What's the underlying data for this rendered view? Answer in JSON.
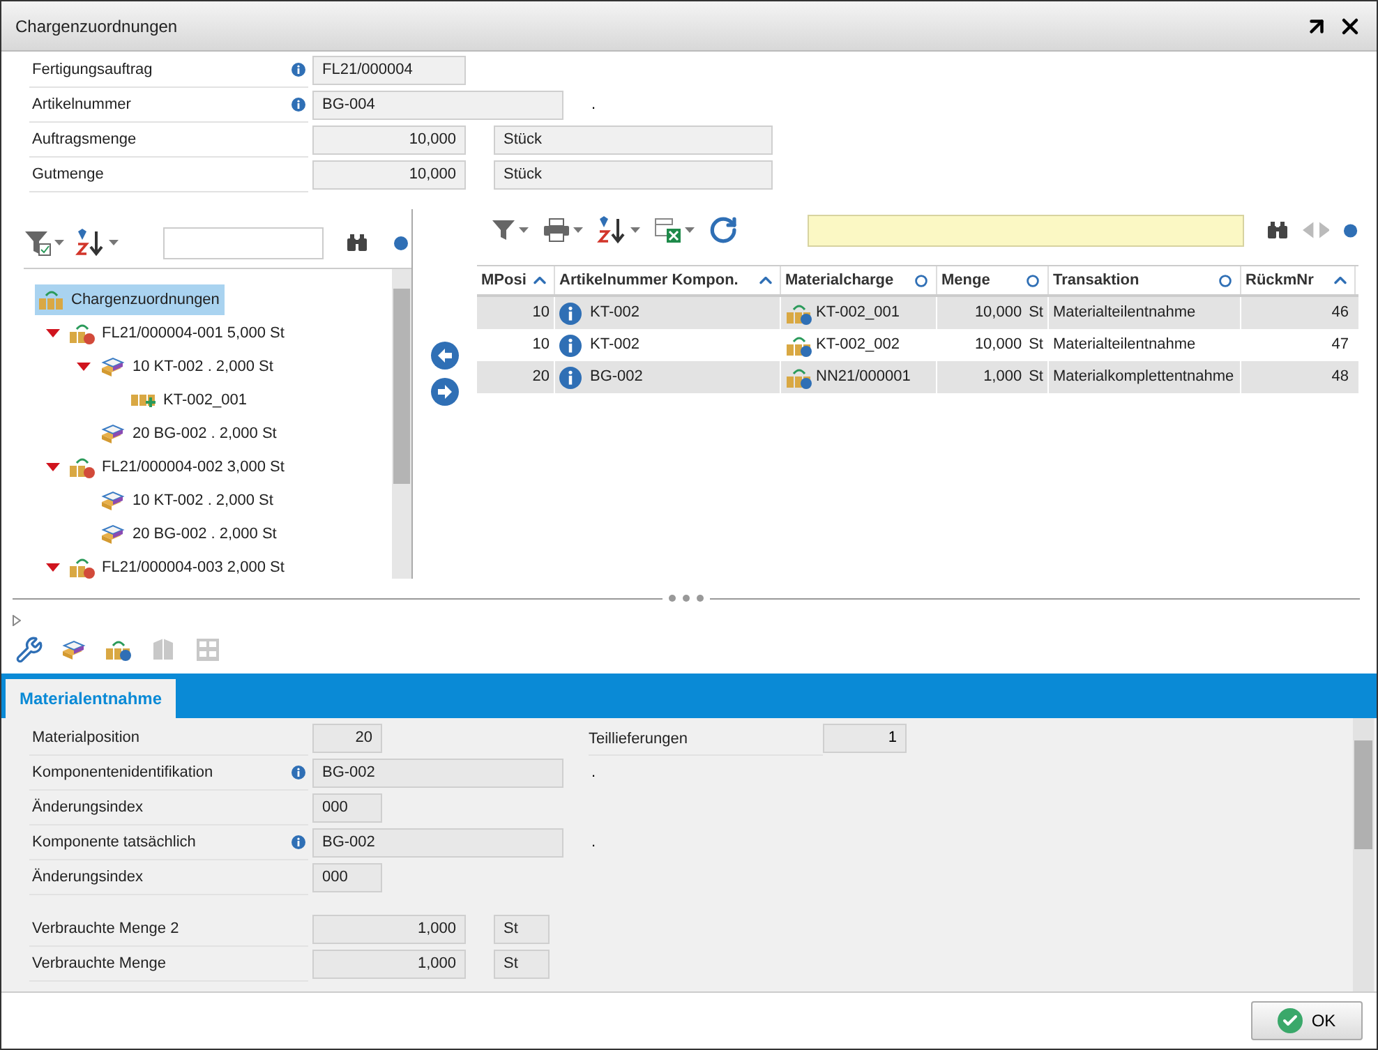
{
  "window": {
    "title": "Chargenzuordnungen"
  },
  "header_fields": [
    {
      "label": "Fertigungsauftrag",
      "info": true,
      "kind": "short",
      "value": "FL21/000004"
    },
    {
      "label": "Artikelnummer",
      "info": true,
      "kind": "long",
      "value": "BG-004",
      "note": "."
    },
    {
      "label": "Auftragsmenge",
      "info": false,
      "kind": "number",
      "value": "10,000",
      "unit": "Stück"
    },
    {
      "label": "Gutmenge",
      "info": false,
      "kind": "number",
      "value": "10,000",
      "unit": "Stück"
    }
  ],
  "tree": [
    {
      "label": "Chargenzuordnungen",
      "kind": "batch",
      "selected": true,
      "children": [
        {
          "label": "FL21/000004-001 5,000 St",
          "kind": "order",
          "selected": false,
          "expanded": true,
          "children": [
            {
              "label": "10 KT-002 . 2,000 St",
              "kind": "component",
              "selected": false,
              "expanded": true,
              "children": [
                {
                  "label": "KT-002_001",
                  "kind": "batch-add",
                  "selected": false
                }
              ]
            },
            {
              "label": "20 BG-002 . 2,000 St",
              "kind": "component",
              "selected": false
            }
          ]
        },
        {
          "label": "FL21/000004-002 3,000 St",
          "kind": "order",
          "selected": false,
          "expanded": true,
          "children": [
            {
              "label": "10 KT-002 . 2,000 St",
              "kind": "component",
              "selected": false
            },
            {
              "label": "20 BG-002 . 2,000 St",
              "kind": "component",
              "selected": false
            }
          ]
        },
        {
          "label": "FL21/000004-003 2,000 St",
          "kind": "order",
          "selected": false,
          "expanded": true
        }
      ]
    }
  ],
  "table": {
    "columns": [
      {
        "label": "MPosi",
        "kind": "asc"
      },
      {
        "label": "Artikelnummer Kompon.",
        "kind": "asc"
      },
      {
        "label": "Materialcharge",
        "kind": "none"
      },
      {
        "label": "Menge",
        "kind": "none"
      },
      {
        "label": "Transaktion",
        "kind": "none"
      },
      {
        "label": "RückmNr",
        "kind": "asc"
      }
    ],
    "rows": [
      {
        "mposi": "10",
        "article": "KT-002",
        "batch": "KT-002_001",
        "quantity": "10,000",
        "unit": "St",
        "transaction": "Materialteilentnahme",
        "feedback_no": "46"
      },
      {
        "mposi": "10",
        "article": "KT-002",
        "batch": "KT-002_002",
        "quantity": "10,000",
        "unit": "St",
        "transaction": "Materialteilentnahme",
        "feedback_no": "47"
      },
      {
        "mposi": "20",
        "article": "BG-002",
        "batch": "NN21/000001",
        "quantity": "1,000",
        "unit": "St",
        "transaction": "Materialkomplettentnahme",
        "feedback_no": "48"
      }
    ]
  },
  "toolbar": [
    {
      "kind": "wrench",
      "disabled": false
    },
    {
      "kind": "components",
      "disabled": false
    },
    {
      "kind": "batch-info",
      "disabled": false
    },
    {
      "kind": "box",
      "disabled": true
    },
    {
      "kind": "shelf",
      "disabled": true
    }
  ],
  "tabs": [
    {
      "label": "Materialentnahme",
      "selected": true
    }
  ],
  "detail_fields": [
    {
      "label": "Materialposition",
      "info": false,
      "kind": "number-short",
      "value": "20",
      "side": {
        "label": "Teillieferungen",
        "value": "1"
      }
    },
    {
      "label": "Komponentenidentifikation",
      "info": true,
      "kind": "long",
      "value": "BG-002",
      "note": "."
    },
    {
      "label": "Änderungsindex",
      "info": false,
      "kind": "code",
      "value": "000"
    },
    {
      "label": "Komponente tatsächlich",
      "info": true,
      "kind": "long",
      "value": "BG-002",
      "note": "."
    },
    {
      "label": "Änderungsindex",
      "info": false,
      "kind": "code",
      "value": "000"
    },
    {
      "label": "Verbrauchte Menge 2",
      "info": false,
      "kind": "number",
      "value": "1,000",
      "unit": "St",
      "gap_before": true
    },
    {
      "label": "Verbrauchte Menge",
      "info": false,
      "kind": "number",
      "value": "1,000",
      "unit": "St"
    }
  ],
  "buttons": [
    {
      "label": "OK"
    }
  ]
}
